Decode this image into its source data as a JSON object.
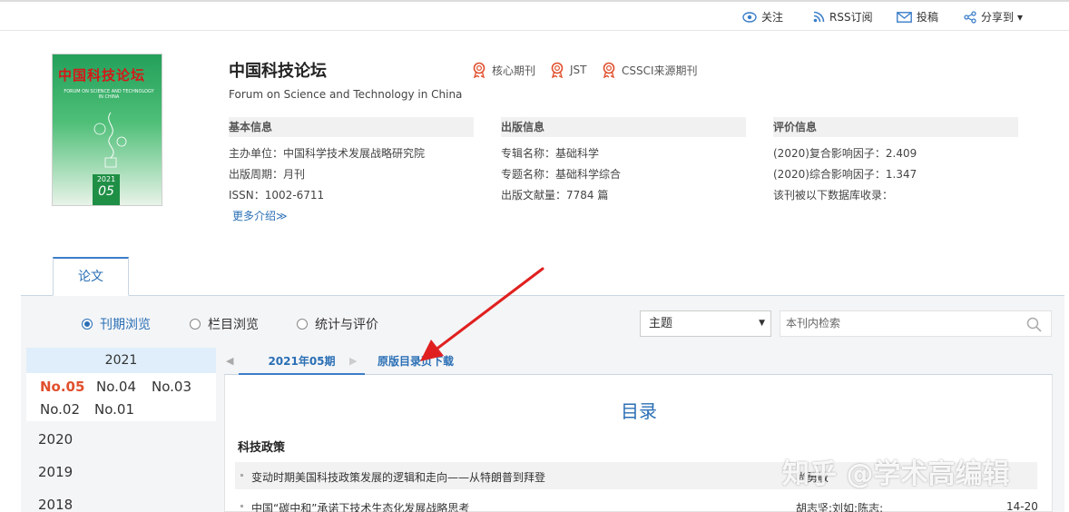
{
  "topnav": {
    "follow": "关注",
    "rss": "RSS订阅",
    "submit": "投稿",
    "share": "分享到",
    "share_arrow": "▾"
  },
  "cover": {
    "title_cn": "中国科技论坛",
    "subtitle_en": "FORUM ON SCIENCE AND TECHNOLOGY IN CHINA",
    "year": "2021",
    "issue": "05"
  },
  "journal": {
    "title": "中国科技论坛",
    "title_en": "Forum on Science and Technology in China",
    "badges": [
      "核心期刊",
      "JST",
      "CSSCI来源期刊"
    ]
  },
  "basic_info": {
    "heading": "基本信息",
    "rows": [
      "主办单位：中国科学技术发展战略研究院",
      "出版周期：月刊",
      "ISSN：1002-6711"
    ],
    "more": "更多介绍≫"
  },
  "pub_info": {
    "heading": "出版信息",
    "rows": [
      "专辑名称：基础科学",
      "专题名称：基础科学综合",
      "出版文献量：7784 篇"
    ]
  },
  "eval_info": {
    "heading": "评价信息",
    "rows": [
      "(2020)复合影响因子：2.409",
      "(2020)综合影响因子：1.347",
      "该刊被以下数据库收录："
    ]
  },
  "tabs": {
    "papers": "论文"
  },
  "browse": {
    "options": [
      "刊期浏览",
      "栏目浏览",
      "统计与评价"
    ],
    "selected": 0,
    "select_value": "主题",
    "search_placeholder": "本刊内检索"
  },
  "years": {
    "current_year": "2021",
    "issues_row1": [
      "No.05",
      "No.04",
      "No.03"
    ],
    "issues_row2": [
      "No.02",
      "No.01"
    ],
    "other_years": [
      "2020",
      "2019",
      "2018"
    ]
  },
  "issue_tabs": {
    "current": "2021年05期",
    "download": "原版目录页下载"
  },
  "content": {
    "toc_title": "目录",
    "section": "科技政策",
    "articles": [
      {
        "title": "变动时期美国科技政策发展的逻辑和走向——从特朗普到拜登",
        "authors": "尚勇敏",
        "pages": ""
      },
      {
        "title": "中国“碳中和”承诺下技术生态化发展战略思考",
        "authors": "胡志坚;刘如;陈志;",
        "pages": "14-20"
      }
    ]
  },
  "watermark": "知乎 @学术高编辑",
  "colors": {
    "accent": "#2a6fb5",
    "current_issue": "#e0502d",
    "arrow": "#e02020",
    "badge": "#e0502d"
  }
}
